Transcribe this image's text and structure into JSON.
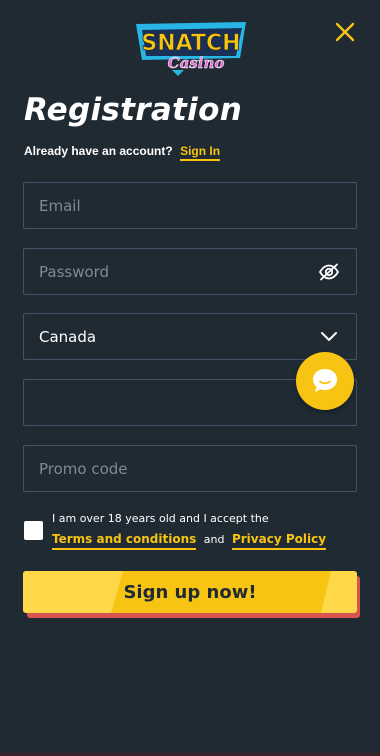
{
  "brand": {
    "logo_line1": "SNATCH",
    "logo_line2": "Casino",
    "accent": "#f7c413"
  },
  "header": {
    "close_icon": "close-icon"
  },
  "form": {
    "title": "Registration",
    "signin_prompt": "Already have an account?",
    "signin_link": "Sign In",
    "email_placeholder": "Email",
    "password_placeholder": "Password",
    "country_value": "Canada",
    "phone_value": "",
    "promo_placeholder": "Promo code",
    "terms_text": "I am over 18 years old and I accept the",
    "terms_link": "Terms and conditions",
    "terms_and": "and",
    "privacy_link": "Privacy Policy",
    "submit_label": "Sign up now!"
  },
  "colors": {
    "background": "#1f2a33",
    "field_border": "#3f546b",
    "button": "#f7c413",
    "button_shadow": "#d9534f"
  }
}
